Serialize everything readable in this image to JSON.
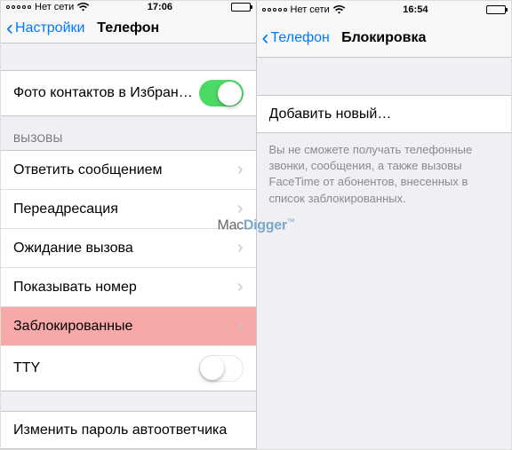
{
  "watermark": {
    "part1": "Mac",
    "part2": "Digger",
    "tm": "™"
  },
  "left": {
    "status": {
      "carrier": "Нет сети",
      "time": "17:06"
    },
    "nav": {
      "back": "Настройки",
      "title": "Телефон"
    },
    "favoritesPhotos": {
      "label": "Фото контактов в Избранном",
      "enabled": true
    },
    "callsHeader": "ВЫЗОВЫ",
    "rows": {
      "respond": "Ответить сообщением",
      "forwarding": "Переадресация",
      "waiting": "Ожидание вызова",
      "showNumber": "Показывать номер",
      "blocked": "Заблокированные",
      "tty": "TTY"
    },
    "ttyEnabled": false,
    "changeVoicemailPwd": "Изменить пароль автоответчика"
  },
  "right": {
    "status": {
      "carrier": "Нет сети",
      "time": "16:54"
    },
    "nav": {
      "back": "Телефон",
      "title": "Блокировка"
    },
    "addNew": "Добавить новый…",
    "footer": "Вы не сможете получать телефонные звонки, сообщения, а также вызовы FaceTime от абонентов, внесенных в список заблокированных."
  }
}
